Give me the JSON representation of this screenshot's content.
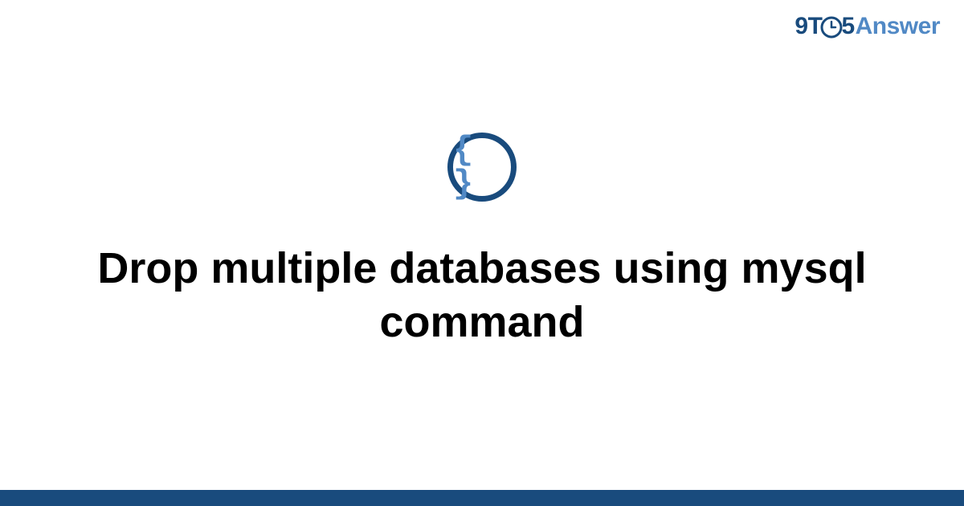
{
  "logo": {
    "part1": "9T",
    "part2": "5",
    "part3": "Answer"
  },
  "icon": {
    "symbol": "{ }"
  },
  "main": {
    "title": "Drop multiple databases using mysql command"
  },
  "colors": {
    "primary": "#194b7d",
    "secondary": "#5189c5"
  }
}
